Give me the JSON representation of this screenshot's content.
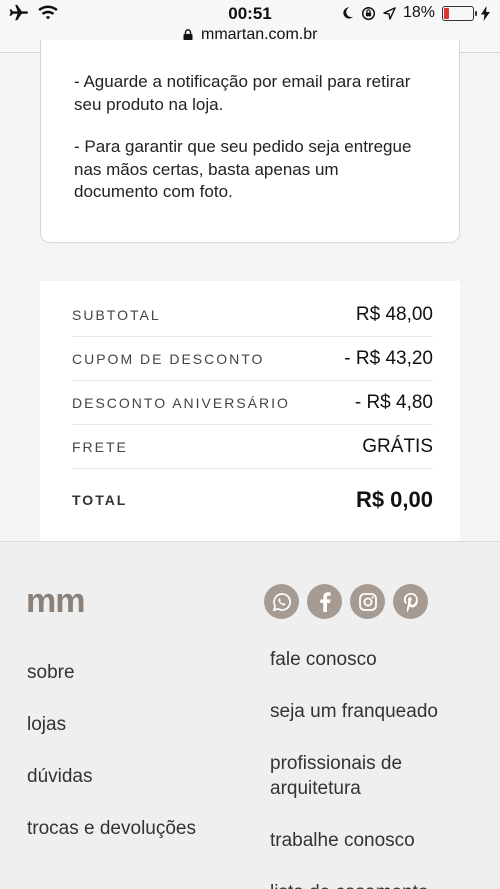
{
  "status_bar": {
    "time": "00:51",
    "battery_percent": "18%",
    "battery_level": 0.18,
    "battery_color": "#e0332d"
  },
  "url": "mmartan.com.br",
  "info": {
    "paragraphs": [
      "- Aguarde a notificação por email para retirar seu produto na loja.",
      "- Para garantir que seu pedido seja entregue nas mãos certas, basta apenas um documento com foto."
    ]
  },
  "totals": {
    "rows": [
      {
        "label": "SUBTOTAL",
        "value": "R$ 48,00"
      },
      {
        "label": "CUPOM DE DESCONTO",
        "value": "- R$ 43,20"
      },
      {
        "label": "DESCONTO ANIVERSÁRIO",
        "value": "- R$ 4,80"
      },
      {
        "label": "FRETE",
        "value": "GRÁTIS"
      }
    ],
    "total_label": "TOTAL",
    "total_value": "R$ 0,00"
  },
  "footer": {
    "logo": "mm",
    "brand_color": "#8c8178",
    "socials": [
      "whatsapp-icon",
      "facebook-icon",
      "instagram-icon",
      "pinterest-icon"
    ],
    "left_links": [
      "sobre",
      "lojas",
      "dúvidas",
      "trocas e devoluções"
    ],
    "right_links": [
      "fale conosco",
      "seja um franqueado",
      "profissionais de arquitetura",
      "trabalhe conosco",
      "lista de casamento"
    ]
  }
}
